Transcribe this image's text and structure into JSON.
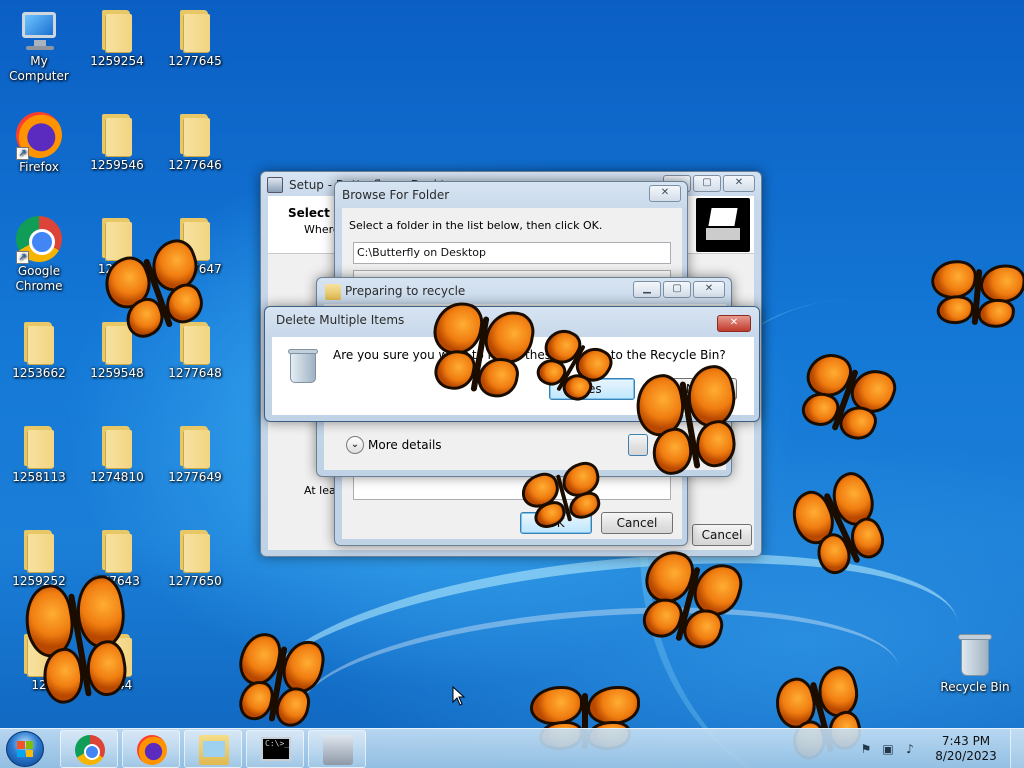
{
  "desktop": {
    "icons": [
      {
        "label": "My Computer"
      },
      {
        "label": "1259254"
      },
      {
        "label": "1277645"
      },
      {
        "label": "Firefox"
      },
      {
        "label": "1259546"
      },
      {
        "label": "1277646"
      },
      {
        "label": "Google Chrome"
      },
      {
        "label": "12595"
      },
      {
        "label": "1277647"
      },
      {
        "label": "1253662"
      },
      {
        "label": "1259548"
      },
      {
        "label": "1277648"
      },
      {
        "label": "1258113"
      },
      {
        "label": "1274810"
      },
      {
        "label": "1277649"
      },
      {
        "label": "1259252"
      },
      {
        "label": "277643"
      },
      {
        "label": "1277650"
      },
      {
        "label": "12"
      },
      {
        "label": "7644"
      },
      {
        "label": "Recycle Bin"
      }
    ]
  },
  "setup_window": {
    "title": "Setup - Butterfly on Desktop",
    "heading": "Select D",
    "subtext": "Where",
    "footer_text": "At leas",
    "cancel_label": "Cancel"
  },
  "browse_dialog": {
    "title": "Browse For Folder",
    "instruction": "Select a folder in the list below, then click OK.",
    "path_value": "C:\\Butterfly on Desktop",
    "ok_label": "OK",
    "cancel_label": "Cancel"
  },
  "preparing_dialog": {
    "title": "Preparing to recycle",
    "more_details_label": "More details"
  },
  "delete_dialog": {
    "title": "Delete Multiple Items",
    "message": "Are you sure you want to move these 2 items to the Recycle Bin?",
    "yes_label": "Yes",
    "no_label": "No"
  },
  "caption_buttons": {
    "minimize": "▁",
    "maximize": "▢",
    "close": "✕"
  },
  "taskbar": {
    "cmd_text": "C:\\>_",
    "clock_time": "7:43 PM",
    "clock_date": "8/20/2023"
  },
  "colors": {
    "butterfly_orange": "#f07d10",
    "close_red": "#c0392b"
  }
}
